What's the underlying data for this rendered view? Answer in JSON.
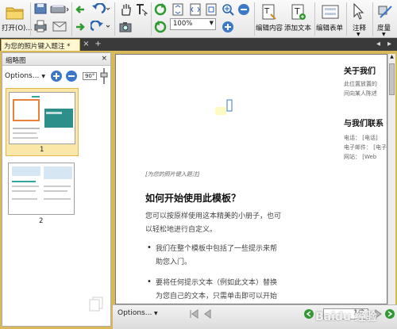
{
  "toolbar": {
    "open_label": "打开(O)...",
    "zoom_value": "100%",
    "edit_content_label": "编辑内容",
    "add_text_label": "添加文本",
    "edit_form_label": "编辑表单",
    "annotate_label": "注释",
    "measure_label": "度量"
  },
  "tabs": [
    {
      "label": "为您的照片键入题注 *",
      "close": "×"
    }
  ],
  "tabbar_add": "+",
  "sidebar": {
    "title": "缩略图",
    "close": "×",
    "options_label": "Options...",
    "rotate_label": "90°",
    "pages": [
      {
        "number": "1",
        "selected": true
      },
      {
        "number": "2",
        "selected": false
      }
    ]
  },
  "document": {
    "caption": "[为您的照片键入题注]",
    "heading": "如何开始使用此模板？",
    "intro_line1": "您可以按原样使用这本精美的小册子，也可",
    "intro_line2": "以轻松地进行自定义。",
    "bullet1_line1": "我们在整个模板中包括了一些提示来帮",
    "bullet1_line2": "助您入门。",
    "bullet2_line1": "要将任何提示文本（例如此文本）替换",
    "bullet2_line2": "为您自己的文本，只需单击即可以开始",
    "right_col": {
      "about_title": "关于我们",
      "about_line1": "此位置放置的",
      "about_line2": "间向某人陈述",
      "contact_title": "与我们联系",
      "phone": "电话： [电话]",
      "email": "电子邮件： [电子",
      "website": "网站： [Web"
    }
  },
  "statusbar": {
    "options_label": "Options...",
    "page_field": "1",
    "page_total": "2"
  },
  "watermark": "Baidu 经验"
}
